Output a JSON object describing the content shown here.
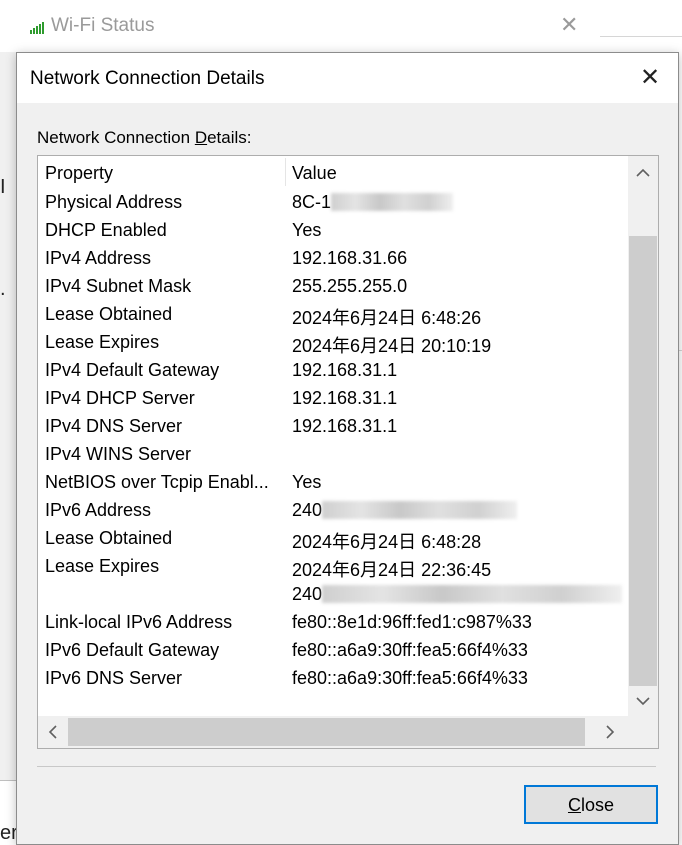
{
  "background_window": {
    "title": "Wi-Fi Status",
    "close_glyph": "✕",
    "icon": "wifi-signal-icon"
  },
  "background_fragments": [
    "I",
    ".",
    "er"
  ],
  "dialog": {
    "title": "Network Connection Details",
    "close_glyph": "✕",
    "group_label_prefix": "Network Connection ",
    "group_label_mnemonic": "D",
    "group_label_suffix": "etails:",
    "columns": {
      "property": "Property",
      "value": "Value"
    },
    "rows": [
      {
        "property": "Physical Address",
        "value": "8C-1",
        "redacted": true
      },
      {
        "property": "DHCP Enabled",
        "value": "Yes"
      },
      {
        "property": "IPv4 Address",
        "value": "192.168.31.66"
      },
      {
        "property": "IPv4 Subnet Mask",
        "value": "255.255.255.0"
      },
      {
        "property": "Lease Obtained",
        "value": "2024年6月24日 6:48:26"
      },
      {
        "property": "Lease Expires",
        "value": "2024年6月24日 20:10:19"
      },
      {
        "property": "IPv4 Default Gateway",
        "value": "192.168.31.1"
      },
      {
        "property": "IPv4 DHCP Server",
        "value": "192.168.31.1"
      },
      {
        "property": "IPv4 DNS Server",
        "value": "192.168.31.1"
      },
      {
        "property": "IPv4 WINS Server",
        "value": ""
      },
      {
        "property": "NetBIOS over Tcpip Enabl...",
        "value": "Yes"
      },
      {
        "property": "IPv6 Address",
        "value": "240",
        "redacted": true
      },
      {
        "property": "Lease Obtained",
        "value": "2024年6月24日 6:48:28"
      },
      {
        "property": "Lease Expires",
        "value": "2024年6月24日 22:36:45"
      },
      {
        "property": "",
        "value": "240",
        "redacted": true
      },
      {
        "property": "Link-local IPv6 Address",
        "value": "fe80::8e1d:96ff:fed1:c987%33"
      },
      {
        "property": "IPv6 Default Gateway",
        "value": "fe80::a6a9:30ff:fea5:66f4%33"
      },
      {
        "property": "IPv6 DNS Server",
        "value": "fe80::a6a9:30ff:fea5:66f4%33"
      }
    ],
    "scroll": {
      "up": "^",
      "down": "v",
      "left": "<",
      "right": ">"
    },
    "close_button": {
      "mnemonic": "C",
      "rest": "lose"
    }
  },
  "colors": {
    "accent": "#0078d7",
    "dialog_bg": "#f0f0f0",
    "list_bg": "#ffffff",
    "scroll_thumb": "#cdcdcd"
  }
}
